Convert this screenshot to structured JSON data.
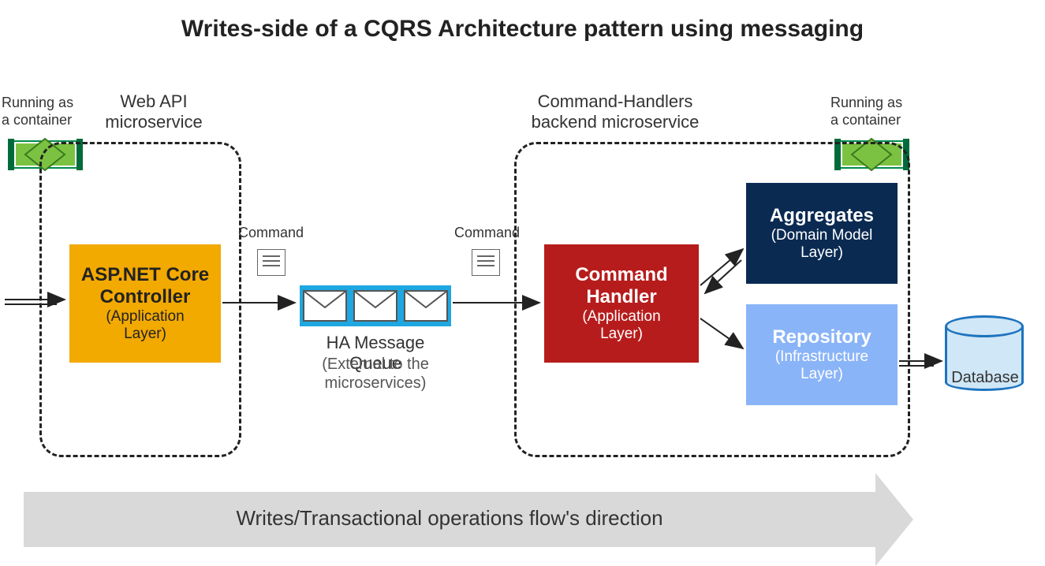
{
  "title": "Writes-side of a CQRS Architecture pattern using messaging",
  "labels": {
    "running_left": "Running as\na container",
    "running_right": "Running as\na container",
    "webapi": "Web API\nmicroservice",
    "backend": "Command-Handlers\nbackend microservice",
    "command1": "Command",
    "command2": "Command",
    "queue_title": "HA Message Queue",
    "queue_sub": "(External to the\nmicroservices)",
    "database": "Database",
    "flow": "Writes/Transactional operations flow's direction"
  },
  "blocks": {
    "controller": {
      "title": "ASP.NET Core\nController",
      "sub": "(Application\nLayer)"
    },
    "handler": {
      "title": "Command\nHandler",
      "sub": "(Application\nLayer)"
    },
    "aggregates": {
      "title": "Aggregates",
      "sub": "(Domain Model\nLayer)"
    },
    "repository": {
      "title": "Repository",
      "sub": "(Infrastructure\nLayer)"
    }
  },
  "colors": {
    "orange": "#f2a900",
    "red": "#b71c1c",
    "navy": "#0a2a52",
    "blue": "#8ab4f8",
    "queue": "#1ea7e1",
    "container_green": "#7cc242",
    "container_dark": "#008a4b"
  }
}
